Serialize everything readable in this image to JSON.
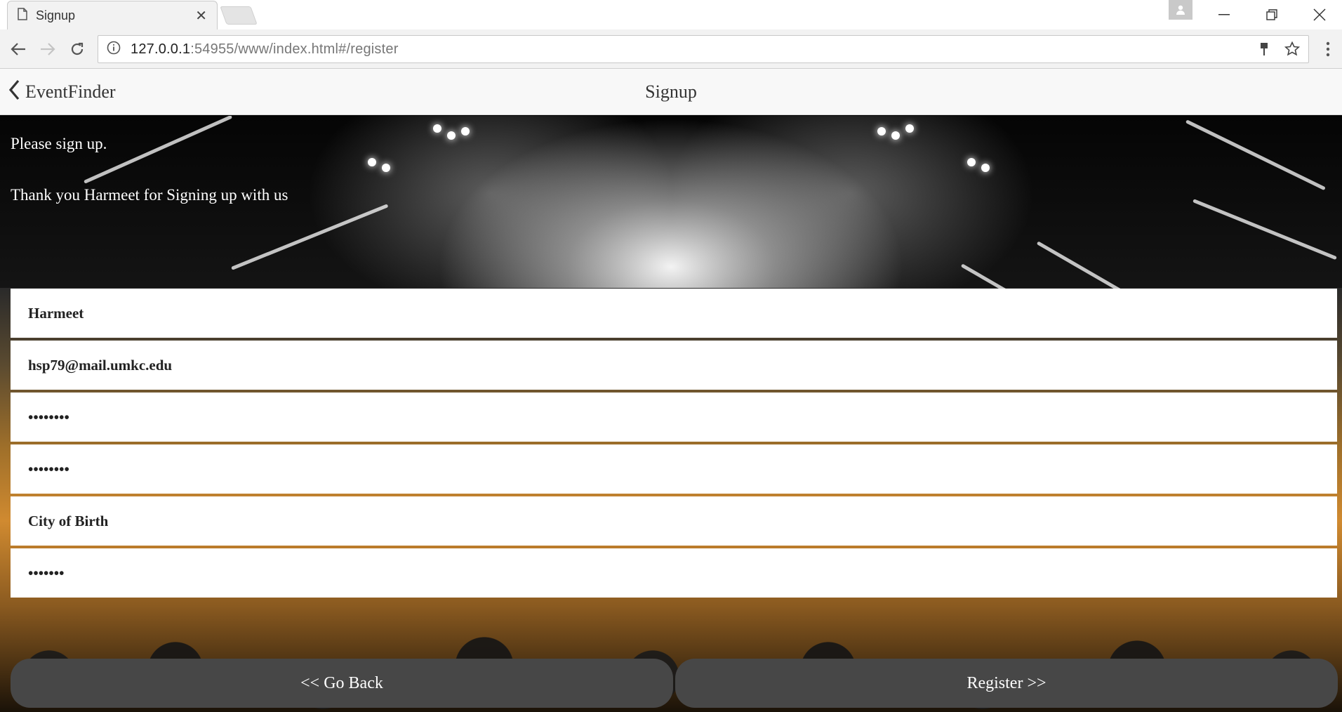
{
  "browser": {
    "tab_title": "Signup",
    "url_host": "127.0.0.1",
    "url_rest": ":54955/www/index.html#/register"
  },
  "header": {
    "back_label": "EventFinder",
    "title": "Signup"
  },
  "messages": {
    "prompt": "Please sign up.",
    "thanks": "Thank you Harmeet for Signing up with us"
  },
  "form": {
    "name": "Harmeet",
    "email": "hsp79@mail.umkc.edu",
    "password": "••••••••",
    "confirm_password": "••••••••",
    "city_placeholder": "City of Birth",
    "security_answer": "•••••••"
  },
  "buttons": {
    "back": "<< Go Back",
    "register": "Register >>"
  },
  "colors": {
    "button_bg": "#474747",
    "header_bg": "#f8f8f8"
  }
}
